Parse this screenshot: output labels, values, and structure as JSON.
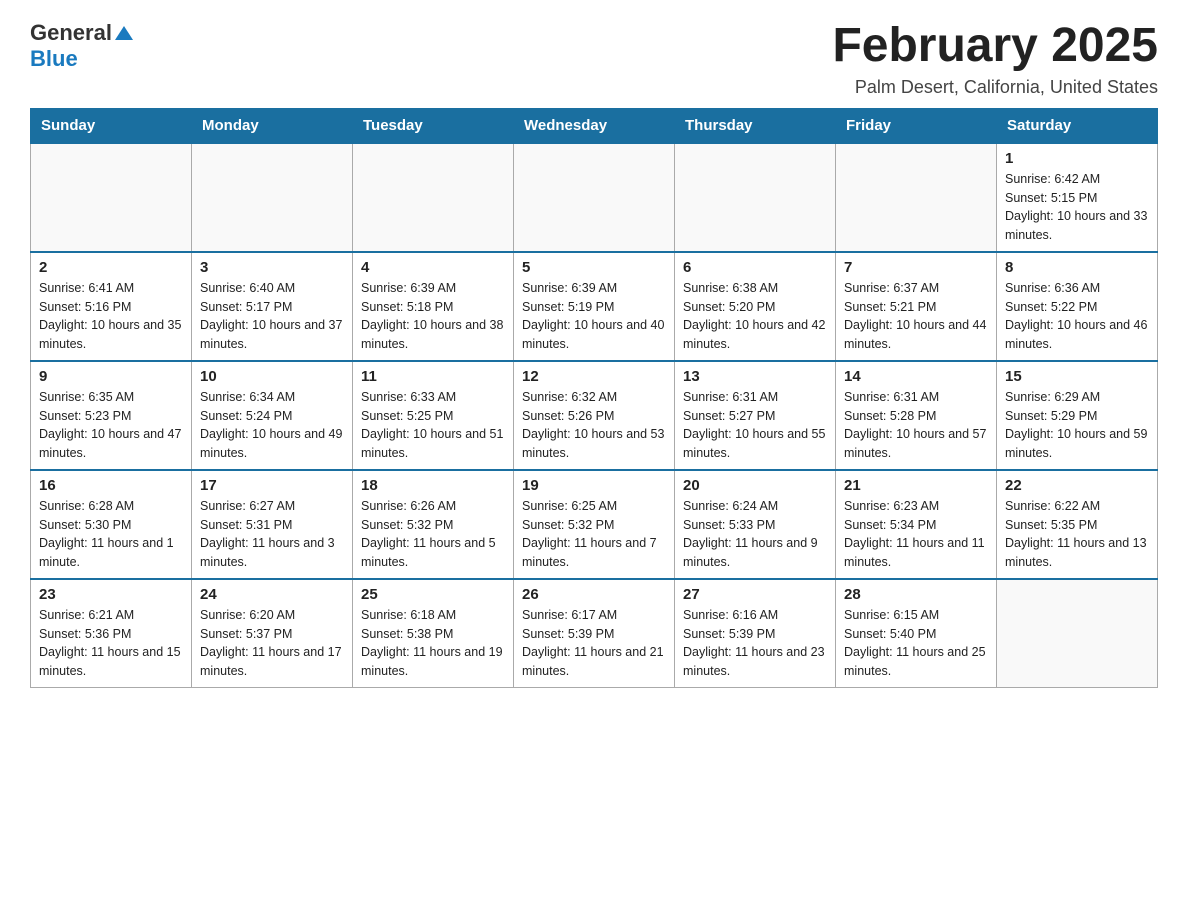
{
  "logo": {
    "general": "General",
    "blue": "Blue"
  },
  "title": {
    "month": "February 2025",
    "location": "Palm Desert, California, United States"
  },
  "days_of_week": [
    "Sunday",
    "Monday",
    "Tuesday",
    "Wednesday",
    "Thursday",
    "Friday",
    "Saturday"
  ],
  "weeks": [
    [
      {
        "day": "",
        "info": ""
      },
      {
        "day": "",
        "info": ""
      },
      {
        "day": "",
        "info": ""
      },
      {
        "day": "",
        "info": ""
      },
      {
        "day": "",
        "info": ""
      },
      {
        "day": "",
        "info": ""
      },
      {
        "day": "1",
        "info": "Sunrise: 6:42 AM\nSunset: 5:15 PM\nDaylight: 10 hours and 33 minutes."
      }
    ],
    [
      {
        "day": "2",
        "info": "Sunrise: 6:41 AM\nSunset: 5:16 PM\nDaylight: 10 hours and 35 minutes."
      },
      {
        "day": "3",
        "info": "Sunrise: 6:40 AM\nSunset: 5:17 PM\nDaylight: 10 hours and 37 minutes."
      },
      {
        "day": "4",
        "info": "Sunrise: 6:39 AM\nSunset: 5:18 PM\nDaylight: 10 hours and 38 minutes."
      },
      {
        "day": "5",
        "info": "Sunrise: 6:39 AM\nSunset: 5:19 PM\nDaylight: 10 hours and 40 minutes."
      },
      {
        "day": "6",
        "info": "Sunrise: 6:38 AM\nSunset: 5:20 PM\nDaylight: 10 hours and 42 minutes."
      },
      {
        "day": "7",
        "info": "Sunrise: 6:37 AM\nSunset: 5:21 PM\nDaylight: 10 hours and 44 minutes."
      },
      {
        "day": "8",
        "info": "Sunrise: 6:36 AM\nSunset: 5:22 PM\nDaylight: 10 hours and 46 minutes."
      }
    ],
    [
      {
        "day": "9",
        "info": "Sunrise: 6:35 AM\nSunset: 5:23 PM\nDaylight: 10 hours and 47 minutes."
      },
      {
        "day": "10",
        "info": "Sunrise: 6:34 AM\nSunset: 5:24 PM\nDaylight: 10 hours and 49 minutes."
      },
      {
        "day": "11",
        "info": "Sunrise: 6:33 AM\nSunset: 5:25 PM\nDaylight: 10 hours and 51 minutes."
      },
      {
        "day": "12",
        "info": "Sunrise: 6:32 AM\nSunset: 5:26 PM\nDaylight: 10 hours and 53 minutes."
      },
      {
        "day": "13",
        "info": "Sunrise: 6:31 AM\nSunset: 5:27 PM\nDaylight: 10 hours and 55 minutes."
      },
      {
        "day": "14",
        "info": "Sunrise: 6:31 AM\nSunset: 5:28 PM\nDaylight: 10 hours and 57 minutes."
      },
      {
        "day": "15",
        "info": "Sunrise: 6:29 AM\nSunset: 5:29 PM\nDaylight: 10 hours and 59 minutes."
      }
    ],
    [
      {
        "day": "16",
        "info": "Sunrise: 6:28 AM\nSunset: 5:30 PM\nDaylight: 11 hours and 1 minute."
      },
      {
        "day": "17",
        "info": "Sunrise: 6:27 AM\nSunset: 5:31 PM\nDaylight: 11 hours and 3 minutes."
      },
      {
        "day": "18",
        "info": "Sunrise: 6:26 AM\nSunset: 5:32 PM\nDaylight: 11 hours and 5 minutes."
      },
      {
        "day": "19",
        "info": "Sunrise: 6:25 AM\nSunset: 5:32 PM\nDaylight: 11 hours and 7 minutes."
      },
      {
        "day": "20",
        "info": "Sunrise: 6:24 AM\nSunset: 5:33 PM\nDaylight: 11 hours and 9 minutes."
      },
      {
        "day": "21",
        "info": "Sunrise: 6:23 AM\nSunset: 5:34 PM\nDaylight: 11 hours and 11 minutes."
      },
      {
        "day": "22",
        "info": "Sunrise: 6:22 AM\nSunset: 5:35 PM\nDaylight: 11 hours and 13 minutes."
      }
    ],
    [
      {
        "day": "23",
        "info": "Sunrise: 6:21 AM\nSunset: 5:36 PM\nDaylight: 11 hours and 15 minutes."
      },
      {
        "day": "24",
        "info": "Sunrise: 6:20 AM\nSunset: 5:37 PM\nDaylight: 11 hours and 17 minutes."
      },
      {
        "day": "25",
        "info": "Sunrise: 6:18 AM\nSunset: 5:38 PM\nDaylight: 11 hours and 19 minutes."
      },
      {
        "day": "26",
        "info": "Sunrise: 6:17 AM\nSunset: 5:39 PM\nDaylight: 11 hours and 21 minutes."
      },
      {
        "day": "27",
        "info": "Sunrise: 6:16 AM\nSunset: 5:39 PM\nDaylight: 11 hours and 23 minutes."
      },
      {
        "day": "28",
        "info": "Sunrise: 6:15 AM\nSunset: 5:40 PM\nDaylight: 11 hours and 25 minutes."
      },
      {
        "day": "",
        "info": ""
      }
    ]
  ]
}
